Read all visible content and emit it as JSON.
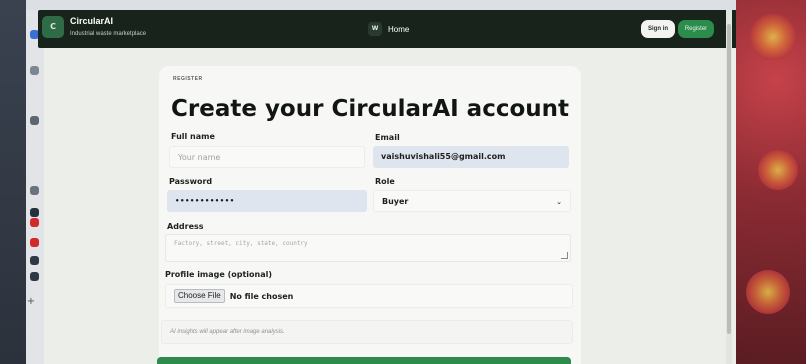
{
  "header": {
    "logo_letter": "C",
    "brand_name": "CircularAI",
    "brand_tagline": "Industrial waste marketplace",
    "nav": {
      "home_badge": "W",
      "home_label": "Home"
    },
    "signin_label": "Sign in",
    "register_label": "Register"
  },
  "form": {
    "eyebrow": "REGISTER",
    "title": "Create your CircularAI account",
    "full_name": {
      "label": "Full name",
      "placeholder": "Your name",
      "value": ""
    },
    "email": {
      "label": "Email",
      "value": "vaishuvishali55@gmail.com"
    },
    "password": {
      "label": "Password",
      "masked_value": "••••••••••••"
    },
    "role": {
      "label": "Role",
      "selected": "Buyer"
    },
    "address": {
      "label": "Address",
      "placeholder": "Factory, street, city, state, country"
    },
    "profile_image": {
      "label": "Profile image (optional)",
      "button_label": "Choose File",
      "status": "No file chosen"
    },
    "hint": "AI insights will appear after image analysis."
  },
  "colors": {
    "header_bg": "#18231c",
    "accent_green": "#2b8c4c",
    "autofill_blue": "#dfe5ef",
    "card_bg": "#f7f8f5"
  }
}
